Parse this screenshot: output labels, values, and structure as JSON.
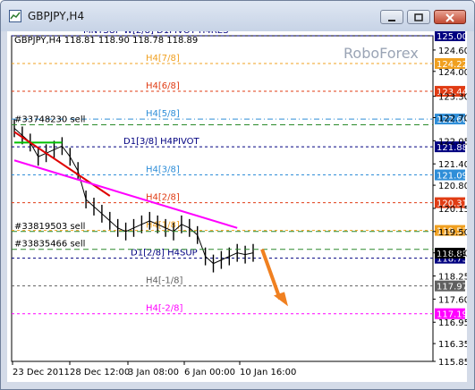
{
  "window": {
    "title": "GBPJPY,H4"
  },
  "chart_header": {
    "symbol": "GBPJPY,H4",
    "ohlc": "118.81 118.90 118.78 118.89"
  },
  "watermark": "RoboForex",
  "colors": {
    "price": "#000000",
    "red_line": "#e00000",
    "magenta_line": "#ff00ff",
    "green_line": "#00c000",
    "arrow": "#f08020"
  },
  "chart_data": {
    "type": "line",
    "x_ticks": [
      "23 Dec 2011",
      "28 Dec 12:00",
      "3 Jan 08:00",
      "6 Jan 00:00",
      "10 Jan 16:00"
    ],
    "y_ticks": [
      "124.60",
      "124.00",
      "123.30",
      "122.70",
      "122.05",
      "121.40",
      "120.80",
      "120.15",
      "119.50",
      "118.90",
      "118.25",
      "117.60",
      "116.95",
      "116.35",
      "115.85"
    ],
    "ylim": [
      115.85,
      125.0
    ],
    "levels": [
      {
        "label": "MNTSUP W[2/8] D1PIVOT H4RES",
        "value": 125.0,
        "price_label": "125.00",
        "color": "#000080",
        "style": "dashed"
      },
      {
        "label": "H4[7/8]",
        "value": 124.22,
        "price_label": "124.22",
        "color": "#f0a020",
        "style": "dashed"
      },
      {
        "label": "H4[6/8]",
        "value": 123.44,
        "price_label": "123.44",
        "color": "#e03c14",
        "style": "dashed"
      },
      {
        "label": "H4[5/8]",
        "value": 122.66,
        "price_label": "122.66",
        "color": "#2f8ed8",
        "style": "dashdot"
      },
      {
        "label": "D1[3/8] H4PIVOT",
        "value": 121.88,
        "price_label": "121.88",
        "color": "#000080",
        "style": "dashed"
      },
      {
        "label": "H4[3/8]",
        "value": 121.09,
        "price_label": "121.09",
        "color": "#2f8ed8",
        "style": "dashed"
      },
      {
        "label": "H4[2/8]",
        "value": 120.31,
        "price_label": "120.31",
        "color": "#e03c14",
        "style": "dashed"
      },
      {
        "label": "H4[1/8]",
        "value": 119.53,
        "price_label": "119.53",
        "color": "#f0a020",
        "style": "dashed"
      },
      {
        "label": "D1[2/8] H4SUP",
        "value": 118.75,
        "price_label": "118.75",
        "color": "#000080",
        "style": "dashed"
      },
      {
        "label": "H4[-1/8]",
        "value": 117.97,
        "price_label": "117.97",
        "color": "#606060",
        "style": "dashed"
      },
      {
        "label": "H4[-2/8]",
        "value": 117.19,
        "price_label": "117.19",
        "color": "#ff00ff",
        "style": "dashed"
      }
    ],
    "current_price": {
      "value": 118.89,
      "price_label": "118.89"
    },
    "orders": [
      {
        "label": "#33748230 sell",
        "value": 122.5
      },
      {
        "label": "#33819503 sell",
        "value": 119.5
      },
      {
        "label": "#33835466 sell",
        "value": 119.0
      }
    ],
    "price_series": [
      122.4,
      122.2,
      122.0,
      121.6,
      121.7,
      121.8,
      121.9,
      121.6,
      121.2,
      120.4,
      120.2,
      120.0,
      119.8,
      119.6,
      119.5,
      119.6,
      119.7,
      119.8,
      119.7,
      119.6,
      119.5,
      119.7,
      119.6,
      119.4,
      118.8,
      118.6,
      118.7,
      118.8,
      118.9,
      118.85,
      118.9
    ],
    "series": [
      {
        "color": "#00c000",
        "x_index": [
          0,
          6
        ],
        "values": [
          122.0,
          122.0
        ]
      },
      {
        "color": "#e00000",
        "x_index": [
          0,
          12
        ],
        "values": [
          122.3,
          120.5
        ]
      },
      {
        "color": "#ff00ff",
        "x_index": [
          0,
          28
        ],
        "values": [
          121.5,
          119.6
        ]
      }
    ],
    "arrow": {
      "from": 119.0,
      "to": 117.4
    }
  }
}
